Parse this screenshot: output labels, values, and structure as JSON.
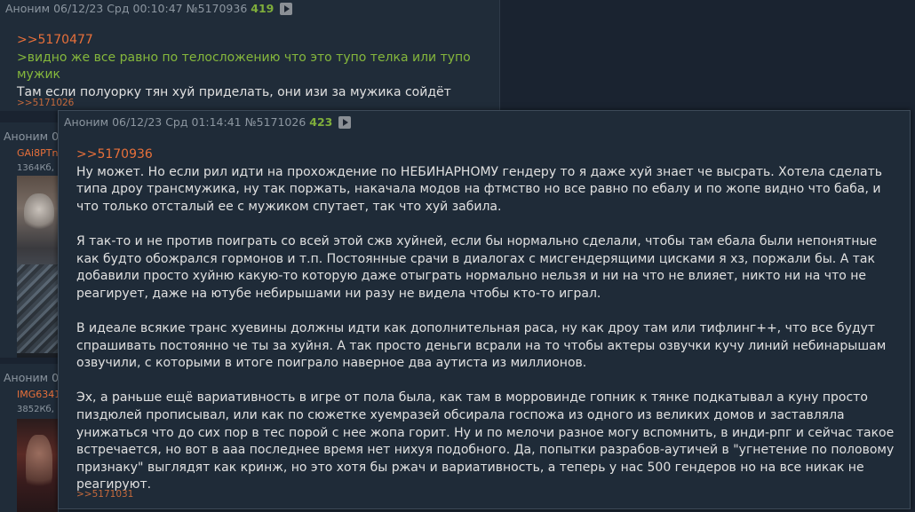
{
  "post1": {
    "name": "Аноним",
    "date": "06/12/23 Срд 00:10:47",
    "number": "№5170936",
    "count": "419",
    "reply_link": ">>5170477",
    "quote": ">видно же все равно по телосложению что это тупо телка или тупо мужик",
    "text": "Там если полуорку тян хуй приделать, они изи за мужика сойдёт",
    "backlink": ">>5171026"
  },
  "post2": {
    "name": "Аноним 0",
    "filename": "GAi8PTn",
    "filesize": "1364Кб, ."
  },
  "post3": {
    "name": "Аноним 0",
    "filename": "IMG6341",
    "filesize": "3852Кб, ."
  },
  "popup": {
    "name": "Аноним",
    "date": "06/12/23 Срд 01:14:41",
    "number": "№5171026",
    "count": "423",
    "reply_link": ">>5170936",
    "paragraphs": [
      "Ну может. Но если рил идти на прохождение по НЕБИНАРНОМУ гендеру то я даже хуй знает че высрать. Хотела сделать типа дроу трансмужика, ну так поржать, накачала модов на фтмство но все равно по ебалу и по жопе видно что баба, и что только отсталый ее с мужиком спутает, так что хуй забила.",
      "Я так-то и не против поиграть со всей этой сжв хуйней, если бы нормально сделали, чтобы там ебала были непонятные как будто обожрался гормонов и т.п. Постоянные срачи в диалогах с мисгендерящими цисками я хз, поржали бы. А так добавили просто хуйню какую-то которую даже отыграть нормально нельзя и ни на что не влияет, никто ни на что не реагирует, даже на ютубе небирышами ни разу не видела чтобы кто-то играл.",
      "В идеале всякие транс хуевины должны идти как дополнительная раса, ну как дроу там или тифлинг++, что все будут спрашивать постоянно че ты за хуйня. А так просто деньги всрали на то чтобы актеры озвучки кучу линий небинарышам озвучили, с которыми в итоге поиграло наверное два аутиста из миллионов.",
      "Эх, а раньше ещё вариативность в игре от пола была, как там в морровинде гопник к тянке подкатывал а куну просто пиздюлей прописывал, или как по сюжетке хуемразей обсирала госпожа из одного из великих домов и заставляла унижаться что до сих пор в тес порой с нее жопа горит. Ну и по мелочи разное могу вспомнить, в инди-рпг и сейчас такое встречается, но вот в ааа последнее время нет нихуя подобного. Да, попытки разрабов-аутичей в \"угнетение по половому признаку\" выглядят как кринж, но это хотя бы ржач и вариативность, а теперь у нас 500 гендеров но на все никак не реагируют."
    ],
    "backlink": ">>5171031"
  },
  "colors": {
    "background": "#1a2330",
    "post_bg": "#202c39",
    "reply_link": "#e8703a",
    "greentext": "#85b73c",
    "count": "#7fae3b"
  },
  "icons": {
    "play": "play-arrow-icon"
  }
}
